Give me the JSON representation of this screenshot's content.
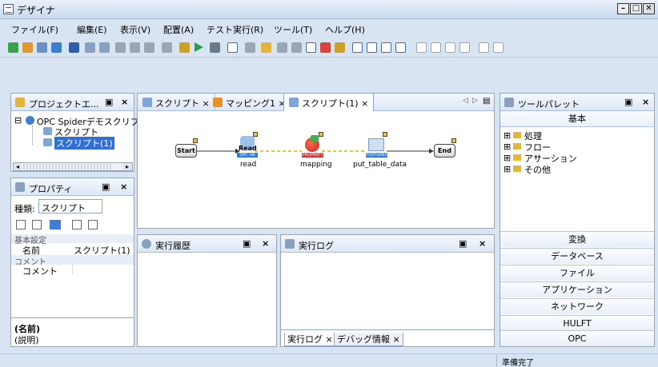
{
  "window": {
    "title": "デザイナ"
  },
  "menu": [
    "ファイル(F)",
    "編集(E)",
    "表示(V)",
    "配置(A)",
    "テスト実行(R)",
    "ツール(T)",
    "ヘルプ(H)"
  ],
  "project_panel": {
    "title": "プロジェクトエ...",
    "root": "OPC Spiderデモスクリプ",
    "items": [
      "スクリプト",
      "スクリプト(1)"
    ]
  },
  "editor_tabs": [
    {
      "label": "スクリプト ×"
    },
    {
      "label": "マッピング1 ×"
    },
    {
      "label": "スクリプト(1) ×"
    }
  ],
  "diagram": {
    "start": "Start",
    "end": "End",
    "read_icon_text": "Read",
    "read_tag": "OPC UA",
    "mapping_tag": "PROPERTY",
    "put_tag": "POSTGRES",
    "nodes": [
      "read",
      "mapping",
      "put_table_data"
    ]
  },
  "properties_panel": {
    "title": "プロパティ",
    "kind_label": "種類:",
    "kind_value": "スクリプト",
    "section_basic": "基本設定",
    "name_key": "名前",
    "name_value": "スクリプト(1)",
    "section_comment": "コメント",
    "comment_key": "コメント",
    "desc_title": "(名前)",
    "desc_text": "(説明)"
  },
  "history_panel": {
    "title": "実行履歴"
  },
  "log_panel": {
    "title": "実行ログ",
    "tabs": [
      "実行ログ ×",
      "デバッグ情報 ×"
    ]
  },
  "palette_panel": {
    "title": "ツールパレット",
    "basic": "基本",
    "tree": [
      "処理",
      "フロー",
      "アサーション",
      "その他"
    ],
    "buttons": [
      "変換",
      "データベース",
      "ファイル",
      "アプリケーション",
      "ネットワーク",
      "HULFT",
      "OPC"
    ]
  },
  "status": {
    "text": "準備完了"
  }
}
